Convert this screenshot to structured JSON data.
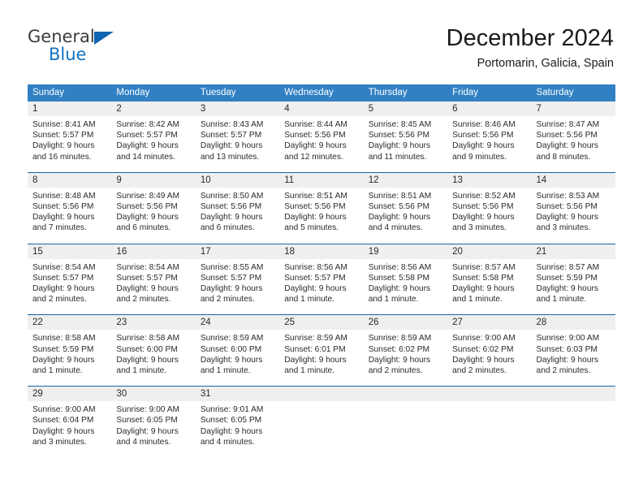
{
  "logo": {
    "word1": "General",
    "word2": "Blue"
  },
  "header": {
    "title": "December 2024",
    "subtitle": "Portomarin, Galicia, Spain"
  },
  "colors": {
    "header_blue": "#3180c4",
    "row_rule_blue": "#1c63a8",
    "daynum_band": "#efefef",
    "logo_blue": "#1273c4",
    "text": "#2b2b2b"
  },
  "calendar": {
    "day_names": [
      "Sunday",
      "Monday",
      "Tuesday",
      "Wednesday",
      "Thursday",
      "Friday",
      "Saturday"
    ],
    "weeks": [
      [
        {
          "day": "1",
          "sunrise": "Sunrise: 8:41 AM",
          "sunset": "Sunset: 5:57 PM",
          "daylight1": "Daylight: 9 hours",
          "daylight2": "and 16 minutes."
        },
        {
          "day": "2",
          "sunrise": "Sunrise: 8:42 AM",
          "sunset": "Sunset: 5:57 PM",
          "daylight1": "Daylight: 9 hours",
          "daylight2": "and 14 minutes."
        },
        {
          "day": "3",
          "sunrise": "Sunrise: 8:43 AM",
          "sunset": "Sunset: 5:57 PM",
          "daylight1": "Daylight: 9 hours",
          "daylight2": "and 13 minutes."
        },
        {
          "day": "4",
          "sunrise": "Sunrise: 8:44 AM",
          "sunset": "Sunset: 5:56 PM",
          "daylight1": "Daylight: 9 hours",
          "daylight2": "and 12 minutes."
        },
        {
          "day": "5",
          "sunrise": "Sunrise: 8:45 AM",
          "sunset": "Sunset: 5:56 PM",
          "daylight1": "Daylight: 9 hours",
          "daylight2": "and 11 minutes."
        },
        {
          "day": "6",
          "sunrise": "Sunrise: 8:46 AM",
          "sunset": "Sunset: 5:56 PM",
          "daylight1": "Daylight: 9 hours",
          "daylight2": "and 9 minutes."
        },
        {
          "day": "7",
          "sunrise": "Sunrise: 8:47 AM",
          "sunset": "Sunset: 5:56 PM",
          "daylight1": "Daylight: 9 hours",
          "daylight2": "and 8 minutes."
        }
      ],
      [
        {
          "day": "8",
          "sunrise": "Sunrise: 8:48 AM",
          "sunset": "Sunset: 5:56 PM",
          "daylight1": "Daylight: 9 hours",
          "daylight2": "and 7 minutes."
        },
        {
          "day": "9",
          "sunrise": "Sunrise: 8:49 AM",
          "sunset": "Sunset: 5:56 PM",
          "daylight1": "Daylight: 9 hours",
          "daylight2": "and 6 minutes."
        },
        {
          "day": "10",
          "sunrise": "Sunrise: 8:50 AM",
          "sunset": "Sunset: 5:56 PM",
          "daylight1": "Daylight: 9 hours",
          "daylight2": "and 6 minutes."
        },
        {
          "day": "11",
          "sunrise": "Sunrise: 8:51 AM",
          "sunset": "Sunset: 5:56 PM",
          "daylight1": "Daylight: 9 hours",
          "daylight2": "and 5 minutes."
        },
        {
          "day": "12",
          "sunrise": "Sunrise: 8:51 AM",
          "sunset": "Sunset: 5:56 PM",
          "daylight1": "Daylight: 9 hours",
          "daylight2": "and 4 minutes."
        },
        {
          "day": "13",
          "sunrise": "Sunrise: 8:52 AM",
          "sunset": "Sunset: 5:56 PM",
          "daylight1": "Daylight: 9 hours",
          "daylight2": "and 3 minutes."
        },
        {
          "day": "14",
          "sunrise": "Sunrise: 8:53 AM",
          "sunset": "Sunset: 5:56 PM",
          "daylight1": "Daylight: 9 hours",
          "daylight2": "and 3 minutes."
        }
      ],
      [
        {
          "day": "15",
          "sunrise": "Sunrise: 8:54 AM",
          "sunset": "Sunset: 5:57 PM",
          "daylight1": "Daylight: 9 hours",
          "daylight2": "and 2 minutes."
        },
        {
          "day": "16",
          "sunrise": "Sunrise: 8:54 AM",
          "sunset": "Sunset: 5:57 PM",
          "daylight1": "Daylight: 9 hours",
          "daylight2": "and 2 minutes."
        },
        {
          "day": "17",
          "sunrise": "Sunrise: 8:55 AM",
          "sunset": "Sunset: 5:57 PM",
          "daylight1": "Daylight: 9 hours",
          "daylight2": "and 2 minutes."
        },
        {
          "day": "18",
          "sunrise": "Sunrise: 8:56 AM",
          "sunset": "Sunset: 5:57 PM",
          "daylight1": "Daylight: 9 hours",
          "daylight2": "and 1 minute."
        },
        {
          "day": "19",
          "sunrise": "Sunrise: 8:56 AM",
          "sunset": "Sunset: 5:58 PM",
          "daylight1": "Daylight: 9 hours",
          "daylight2": "and 1 minute."
        },
        {
          "day": "20",
          "sunrise": "Sunrise: 8:57 AM",
          "sunset": "Sunset: 5:58 PM",
          "daylight1": "Daylight: 9 hours",
          "daylight2": "and 1 minute."
        },
        {
          "day": "21",
          "sunrise": "Sunrise: 8:57 AM",
          "sunset": "Sunset: 5:59 PM",
          "daylight1": "Daylight: 9 hours",
          "daylight2": "and 1 minute."
        }
      ],
      [
        {
          "day": "22",
          "sunrise": "Sunrise: 8:58 AM",
          "sunset": "Sunset: 5:59 PM",
          "daylight1": "Daylight: 9 hours",
          "daylight2": "and 1 minute."
        },
        {
          "day": "23",
          "sunrise": "Sunrise: 8:58 AM",
          "sunset": "Sunset: 6:00 PM",
          "daylight1": "Daylight: 9 hours",
          "daylight2": "and 1 minute."
        },
        {
          "day": "24",
          "sunrise": "Sunrise: 8:59 AM",
          "sunset": "Sunset: 6:00 PM",
          "daylight1": "Daylight: 9 hours",
          "daylight2": "and 1 minute."
        },
        {
          "day": "25",
          "sunrise": "Sunrise: 8:59 AM",
          "sunset": "Sunset: 6:01 PM",
          "daylight1": "Daylight: 9 hours",
          "daylight2": "and 1 minute."
        },
        {
          "day": "26",
          "sunrise": "Sunrise: 8:59 AM",
          "sunset": "Sunset: 6:02 PM",
          "daylight1": "Daylight: 9 hours",
          "daylight2": "and 2 minutes."
        },
        {
          "day": "27",
          "sunrise": "Sunrise: 9:00 AM",
          "sunset": "Sunset: 6:02 PM",
          "daylight1": "Daylight: 9 hours",
          "daylight2": "and 2 minutes."
        },
        {
          "day": "28",
          "sunrise": "Sunrise: 9:00 AM",
          "sunset": "Sunset: 6:03 PM",
          "daylight1": "Daylight: 9 hours",
          "daylight2": "and 2 minutes."
        }
      ],
      [
        {
          "day": "29",
          "sunrise": "Sunrise: 9:00 AM",
          "sunset": "Sunset: 6:04 PM",
          "daylight1": "Daylight: 9 hours",
          "daylight2": "and 3 minutes."
        },
        {
          "day": "30",
          "sunrise": "Sunrise: 9:00 AM",
          "sunset": "Sunset: 6:05 PM",
          "daylight1": "Daylight: 9 hours",
          "daylight2": "and 4 minutes."
        },
        {
          "day": "31",
          "sunrise": "Sunrise: 9:01 AM",
          "sunset": "Sunset: 6:05 PM",
          "daylight1": "Daylight: 9 hours",
          "daylight2": "and 4 minutes."
        },
        {
          "day": "",
          "sunrise": "",
          "sunset": "",
          "daylight1": "",
          "daylight2": ""
        },
        {
          "day": "",
          "sunrise": "",
          "sunset": "",
          "daylight1": "",
          "daylight2": ""
        },
        {
          "day": "",
          "sunrise": "",
          "sunset": "",
          "daylight1": "",
          "daylight2": ""
        },
        {
          "day": "",
          "sunrise": "",
          "sunset": "",
          "daylight1": "",
          "daylight2": ""
        }
      ]
    ]
  }
}
